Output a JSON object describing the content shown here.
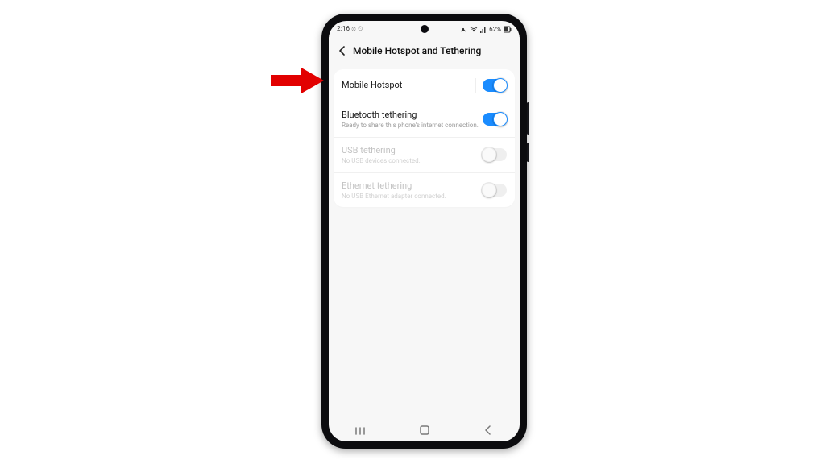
{
  "status": {
    "time": "2:16",
    "icons_left": "⦻ ⏲",
    "battery_text": "62%"
  },
  "header": {
    "title": "Mobile Hotspot and Tethering"
  },
  "rows": [
    {
      "label": "Mobile Hotspot",
      "sub": "",
      "enabled": true,
      "on": true,
      "has_divider": true
    },
    {
      "label": "Bluetooth tethering",
      "sub": "Ready to share this phone's internet connection.",
      "enabled": true,
      "on": true,
      "has_divider": false
    },
    {
      "label": "USB tethering",
      "sub": "No USB devices connected.",
      "enabled": false,
      "on": false,
      "has_divider": false
    },
    {
      "label": "Ethernet tethering",
      "sub": "No USB Ethernet adapter connected.",
      "enabled": false,
      "on": false,
      "has_divider": false
    }
  ]
}
